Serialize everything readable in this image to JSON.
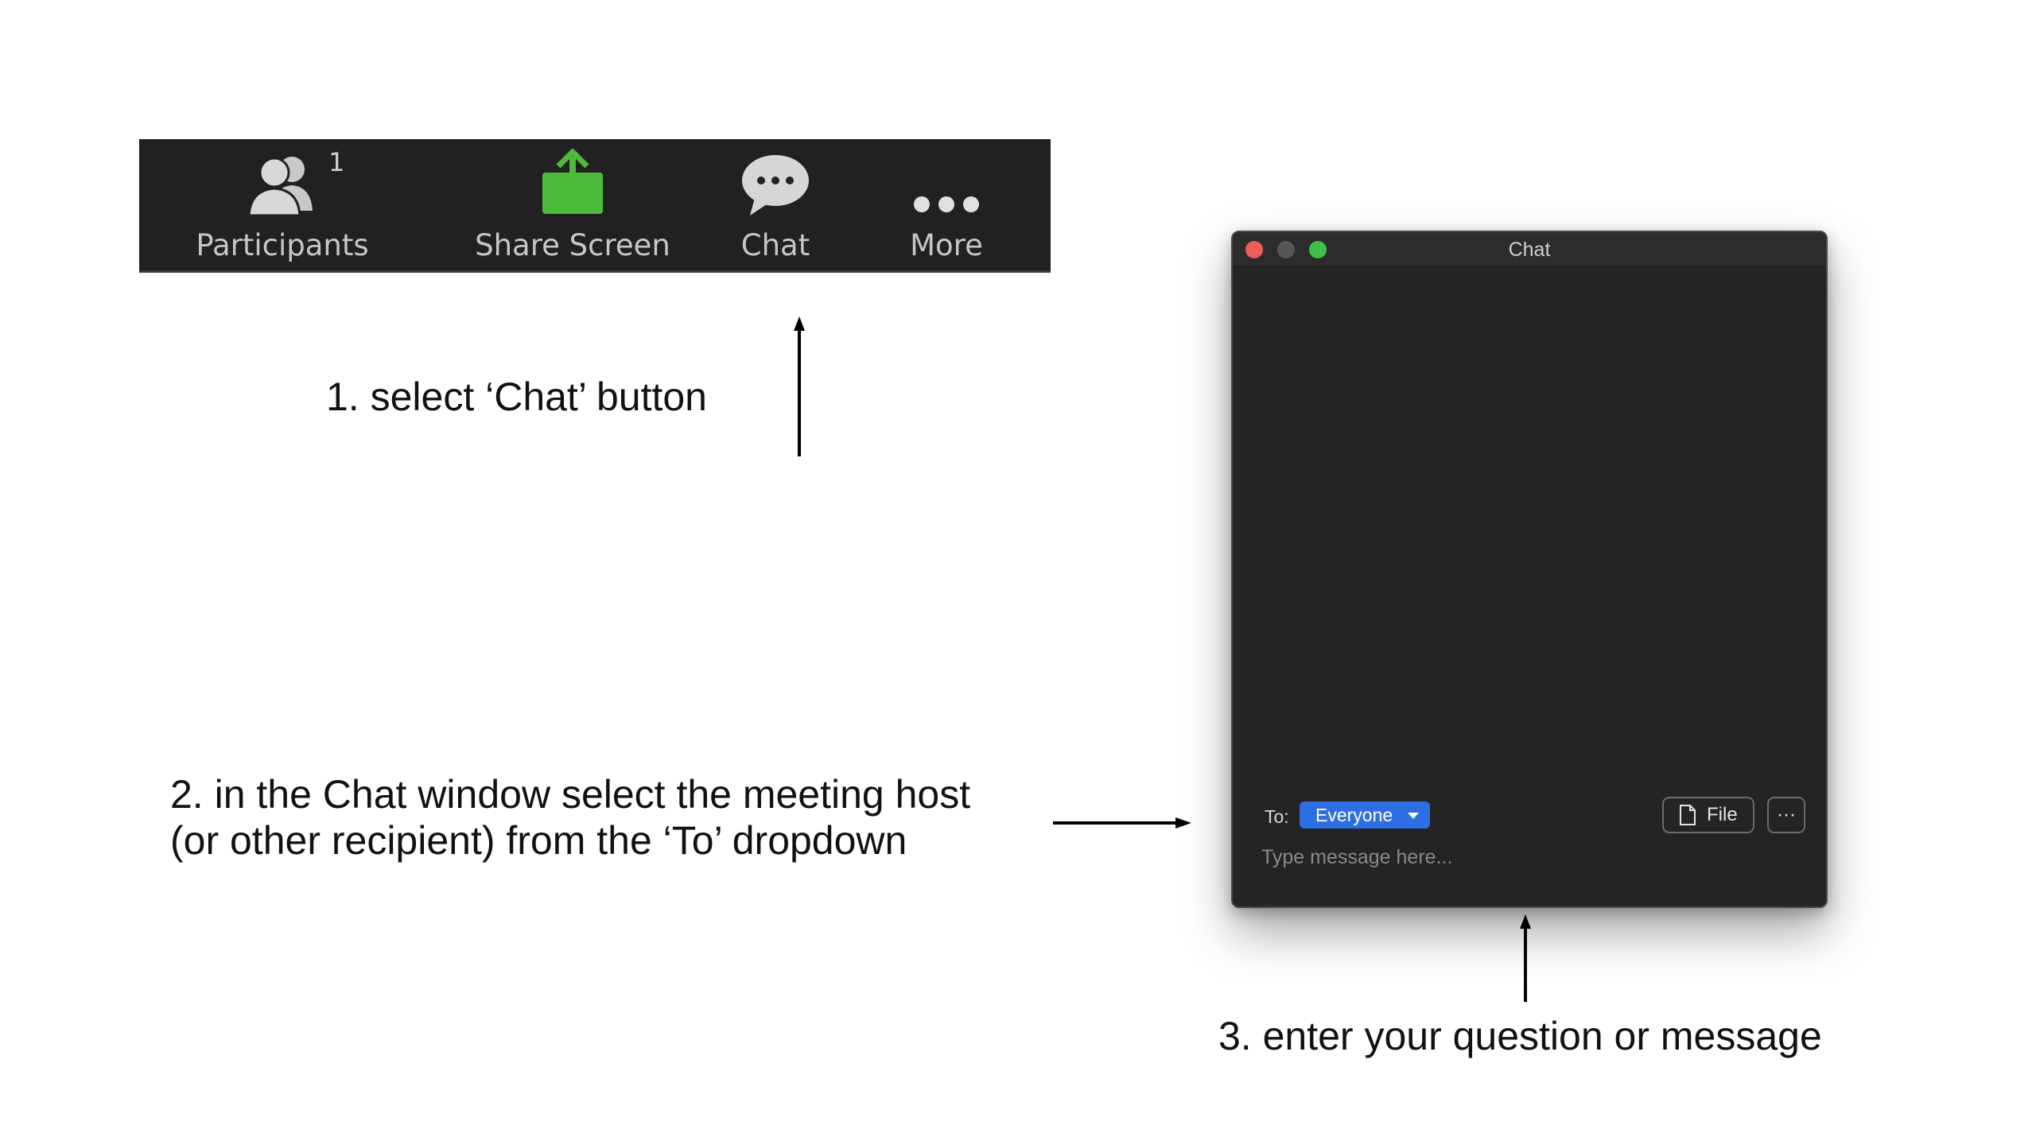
{
  "toolbar": {
    "participants": {
      "label": "Participants",
      "count": "1",
      "icon": "participants-icon"
    },
    "share_screen": {
      "label": "Share Screen",
      "icon": "share-screen-icon",
      "color": "#4dbb3a"
    },
    "chat": {
      "label": "Chat",
      "icon": "chat-bubble-icon"
    },
    "more": {
      "label": "More",
      "icon": "more-dots-icon"
    }
  },
  "annotations": {
    "step1": "1. select ‘Chat’ button",
    "step2_line1": "2. in the Chat window select the meeting host",
    "step2_line2": "(or other recipient) from the ‘To’ dropdown",
    "step3": "3. enter your question or message"
  },
  "chat_window": {
    "title": "Chat",
    "to_label": "To:",
    "recipient": "Everyone",
    "file_button": "File",
    "more_button": "···",
    "message_placeholder": "Type message here...",
    "accent_color": "#2d6fe3"
  }
}
